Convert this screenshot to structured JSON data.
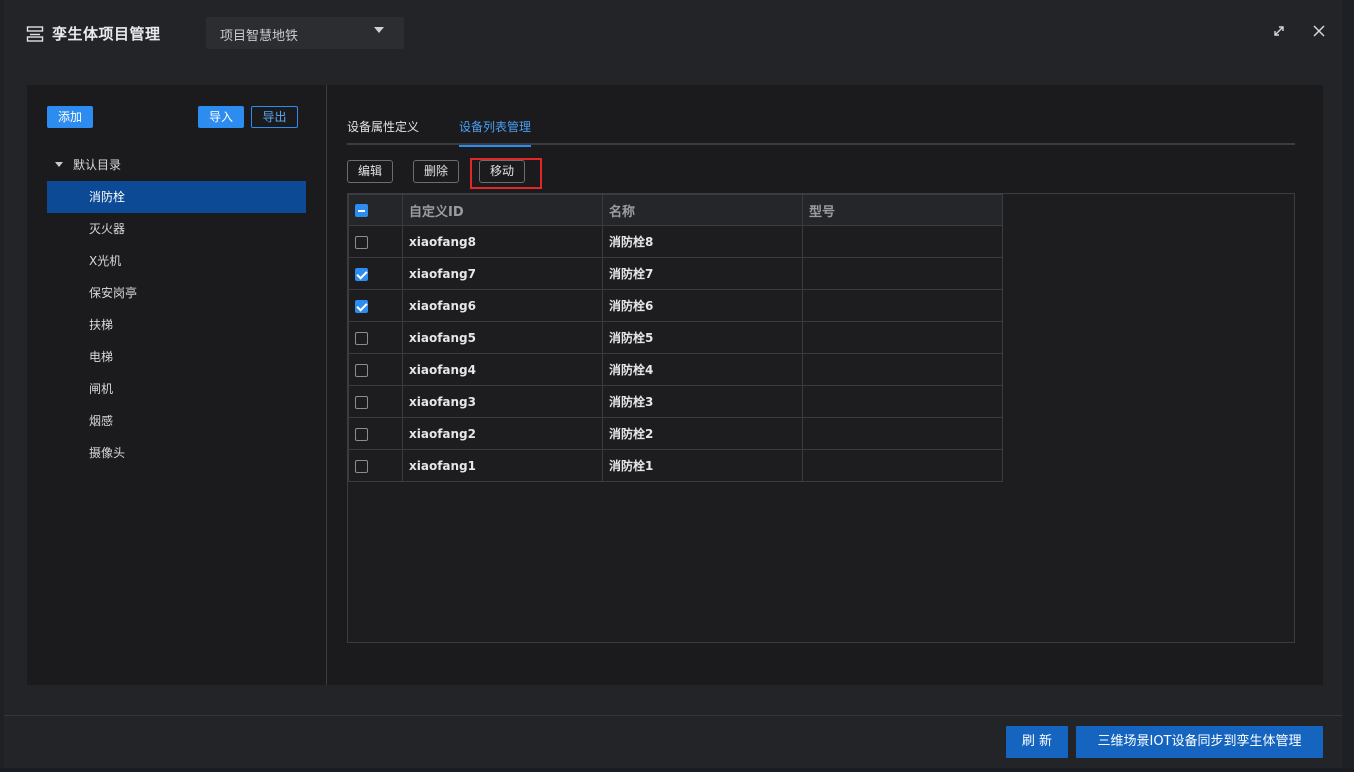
{
  "header": {
    "title": "孪生体项目管理",
    "project_select": "项目智慧地铁"
  },
  "left": {
    "add_label": "添加",
    "import_label": "导入",
    "export_label": "导出",
    "tree_root": "默认目录",
    "items": [
      "消防栓",
      "灭火器",
      "X光机",
      "保安岗亭",
      "扶梯",
      "电梯",
      "闸机",
      "烟感",
      "摄像头"
    ],
    "active_index": 0
  },
  "tabs": {
    "attr_label": "设备属性定义",
    "list_label": "设备列表管理",
    "active": "list"
  },
  "toolbar": {
    "edit_label": "编辑",
    "delete_label": "删除",
    "move_label": "移动"
  },
  "table": {
    "headers": {
      "id": "自定义ID",
      "name": "名称",
      "model": "型号"
    },
    "rows": [
      {
        "id": "xiaofang8",
        "name": "消防栓8",
        "model": "",
        "checked": false
      },
      {
        "id": "xiaofang7",
        "name": "消防栓7",
        "model": "",
        "checked": true
      },
      {
        "id": "xiaofang6",
        "name": "消防栓6",
        "model": "",
        "checked": true
      },
      {
        "id": "xiaofang5",
        "name": "消防栓5",
        "model": "",
        "checked": false
      },
      {
        "id": "xiaofang4",
        "name": "消防栓4",
        "model": "",
        "checked": false
      },
      {
        "id": "xiaofang3",
        "name": "消防栓3",
        "model": "",
        "checked": false
      },
      {
        "id": "xiaofang2",
        "name": "消防栓2",
        "model": "",
        "checked": false
      },
      {
        "id": "xiaofang1",
        "name": "消防栓1",
        "model": "",
        "checked": false
      }
    ]
  },
  "footer": {
    "refresh_label": "刷 新",
    "sync_label": "三维场景IOT设备同步到孪生体管理"
  },
  "colors": {
    "accent": "#2d8cf0",
    "active_tree_bg": "#0d4a96",
    "highlight": "#e0282a"
  }
}
